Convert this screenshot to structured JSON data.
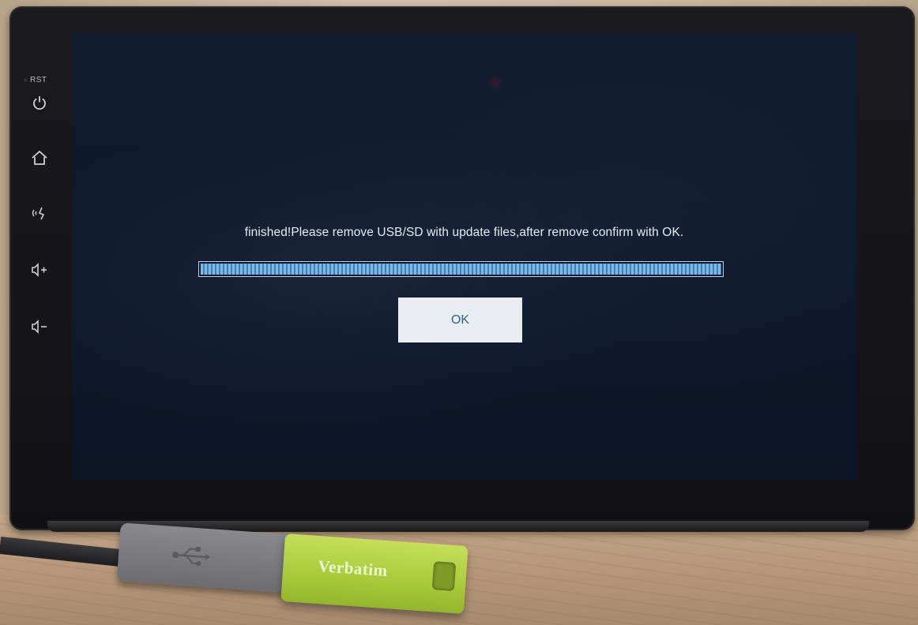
{
  "device": {
    "reset_label": "RST",
    "keys": [
      {
        "icon": "power-icon"
      },
      {
        "icon": "home-icon"
      },
      {
        "icon": "voice-icon"
      },
      {
        "icon": "volume-up-icon"
      },
      {
        "icon": "volume-down-icon"
      }
    ]
  },
  "dialog": {
    "message": "finished!Please remove USB/SD with update files,after remove confirm with OK.",
    "progress_percent": 100,
    "ok_label": "OK"
  },
  "usb_stick": {
    "brand": "Verbatim"
  },
  "colors": {
    "screen_bg": "#0e182a",
    "text": "#e6ecf5",
    "progress": "#7db9e6",
    "button_bg": "#e9edf1",
    "button_text": "#2f5f8a",
    "usb_stick": "#b5d148"
  }
}
